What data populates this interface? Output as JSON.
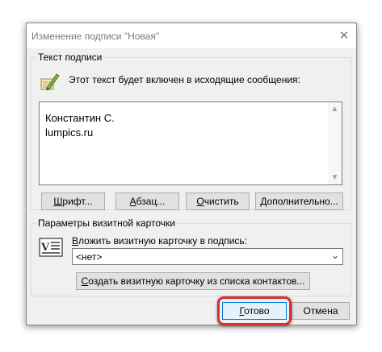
{
  "window": {
    "title": "Изменение подписи \"Новая\"",
    "close_glyph": "✕"
  },
  "signature_group": {
    "legend": "Текст подписи",
    "icon": "quill-pen-icon",
    "info": "Этот текст будет включен в исходящие сообщения:",
    "text_lines": [
      "Константин С.",
      "lumpics.ru"
    ],
    "buttons": {
      "font": {
        "label": "Шрифт...",
        "accel": "Ш",
        "rest": "рифт..."
      },
      "paragraph": {
        "label": "Абзац...",
        "accel": "А",
        "rest": "бзац..."
      },
      "clear": {
        "label": "Очистить",
        "accel": "О",
        "rest": "чистить"
      },
      "advanced": {
        "label": "Дополнительно...",
        "accel": "Д",
        "rest": "ополнительно..."
      }
    }
  },
  "vcard_group": {
    "legend": "Параметры визитной карточки",
    "icon": "business-card-icon",
    "attach_label": {
      "label": "Вложить визитную карточку в подпись:",
      "accel": "В",
      "rest": "ложить визитную карточку в подпись:"
    },
    "select_value": "<нет>",
    "create_button": {
      "label": "Создать визитную карточку из списка контактов...",
      "accel": "С",
      "rest": "оздать визитную карточку из списка контактов..."
    }
  },
  "footer": {
    "ok": {
      "label": "Готово",
      "accel": "Г",
      "rest": "отово"
    },
    "cancel": "Отмена"
  },
  "colors": {
    "highlight": "#d62f2f",
    "dialog_bg": "#f0f0f0",
    "focus_border": "#0078d7"
  }
}
